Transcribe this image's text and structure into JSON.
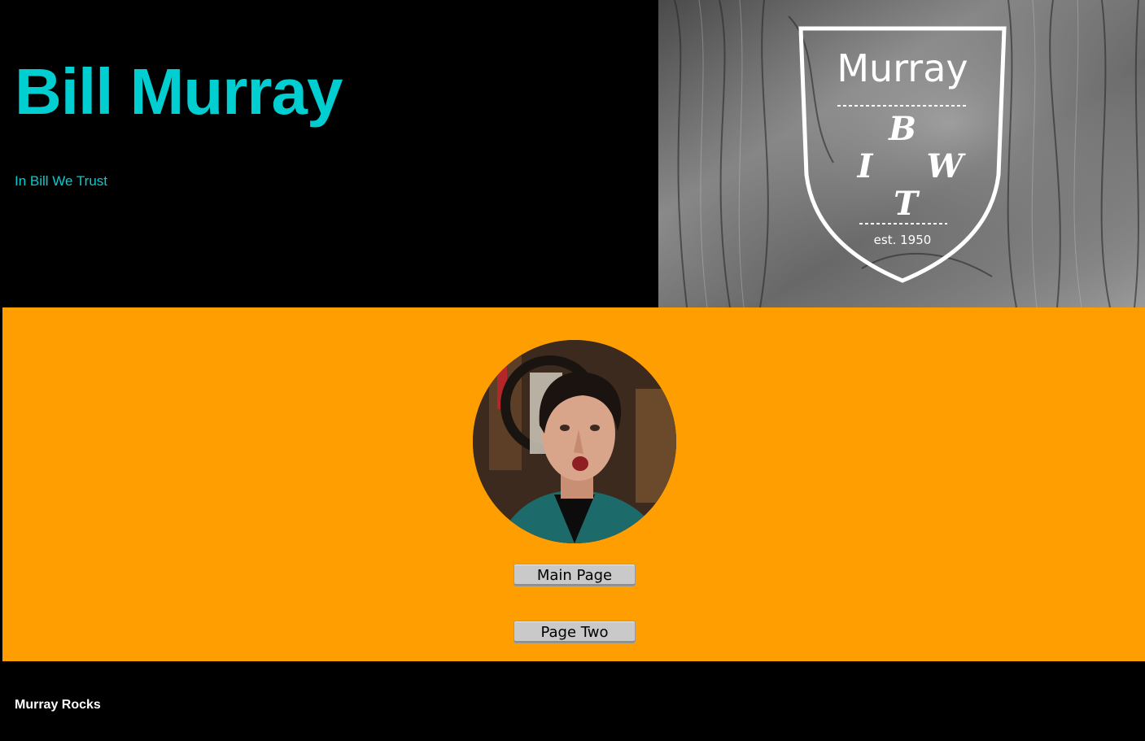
{
  "header": {
    "title": "Bill Murray",
    "tagline": "In Bill We Trust",
    "title_color": "#00CED1"
  },
  "crest": {
    "name": "Murray",
    "letters": [
      "B",
      "I",
      "W",
      "T"
    ],
    "established": "est. 1950",
    "icon": "shield-crest-logo"
  },
  "main": {
    "background_color": "#FF9E00",
    "avatar_icon": "bill-murray-portrait",
    "buttons": {
      "main_page": "Main Page",
      "page_two": "Page Two"
    }
  },
  "footer": {
    "text": "Murray Rocks"
  }
}
